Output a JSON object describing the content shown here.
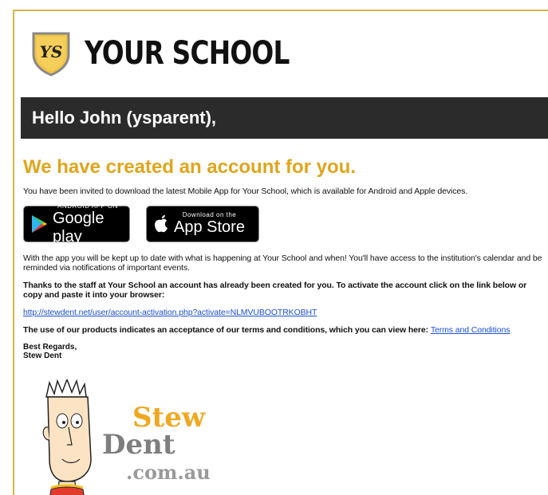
{
  "logo": {
    "badge_text": "YS",
    "title": "YOUR SCHOOL"
  },
  "greeting": "Hello John (ysparent),",
  "headline": "We have created an account for you.",
  "intro": "You have been invited to download the latest Mobile App for Your School, which is available for Android and Apple devices.",
  "badges": {
    "google": {
      "small": "ANDROID APP ON",
      "big": "Google play"
    },
    "apple": {
      "small": "Download on the",
      "big": "App Store"
    }
  },
  "para_updates": "With the app you will be kept up to date with what is happening at Your School and when! You'll have access to the institution's calendar and be reminded via notifications of important events.",
  "para_activate": "Thanks to the staff at Your School an account has already been created for you. To activate the account click on the link below or copy and paste it into your browser:",
  "activation_link": "http://stewdent.net/user/account-activation.php?activate=NLMVUBOOTRKOBHT",
  "terms_text": "The use of our products indicates an acceptance of our terms and conditions, which you can view here: ",
  "terms_link": "Terms and Conditions",
  "signoff": {
    "line1": "Best Regards,",
    "line2": "Stew Dent"
  },
  "brand": {
    "line1": "Stew",
    "line2": "Dent",
    "line3": ".com.au"
  },
  "colors": {
    "accent": "#e0a51c",
    "bar": "#2b2b2b",
    "link": "#1a4fd6",
    "border": "#d9b54a"
  }
}
